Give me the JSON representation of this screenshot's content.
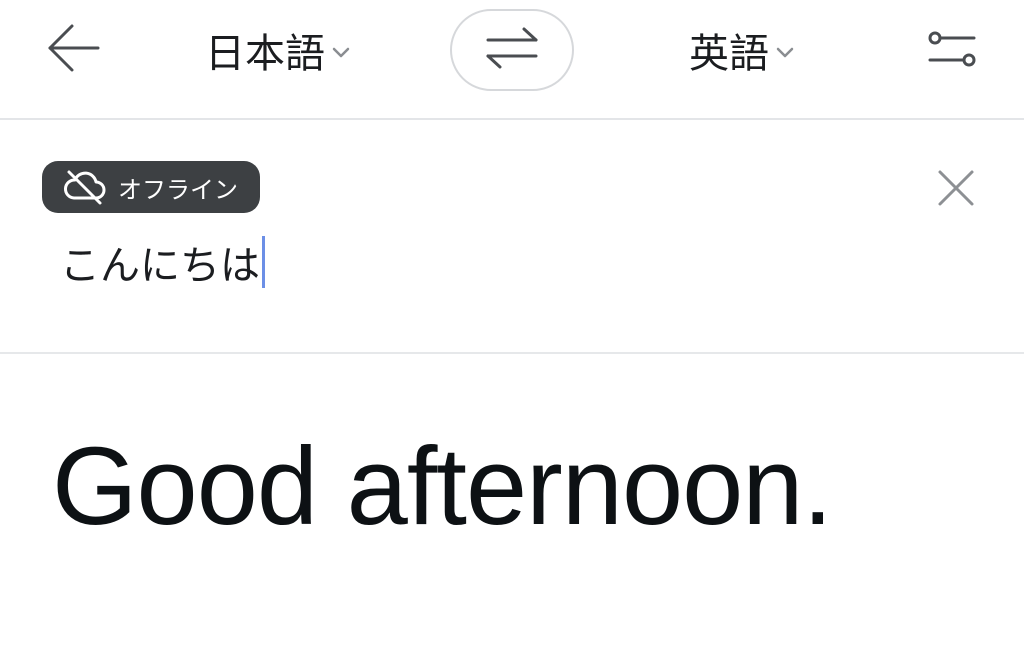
{
  "header": {
    "back_icon": "arrow-left-icon",
    "source_language": "日本語",
    "target_language": "英語",
    "swap_icon": "swap-arrows-icon",
    "settings_icon": "sliders-icon",
    "chevron_icon": "chevron-down-icon"
  },
  "input": {
    "offline_label": "オフライン",
    "offline_icon": "cloud-off-icon",
    "text": "こんにちは",
    "clear_icon": "close-icon"
  },
  "output": {
    "translation": "Good afternoon."
  },
  "colors": {
    "badge_bg": "#3d4043",
    "caret": "#6c8fe6",
    "text": "#111417",
    "icon_gray": "#5f6368",
    "divider": "#e3e5e8"
  }
}
